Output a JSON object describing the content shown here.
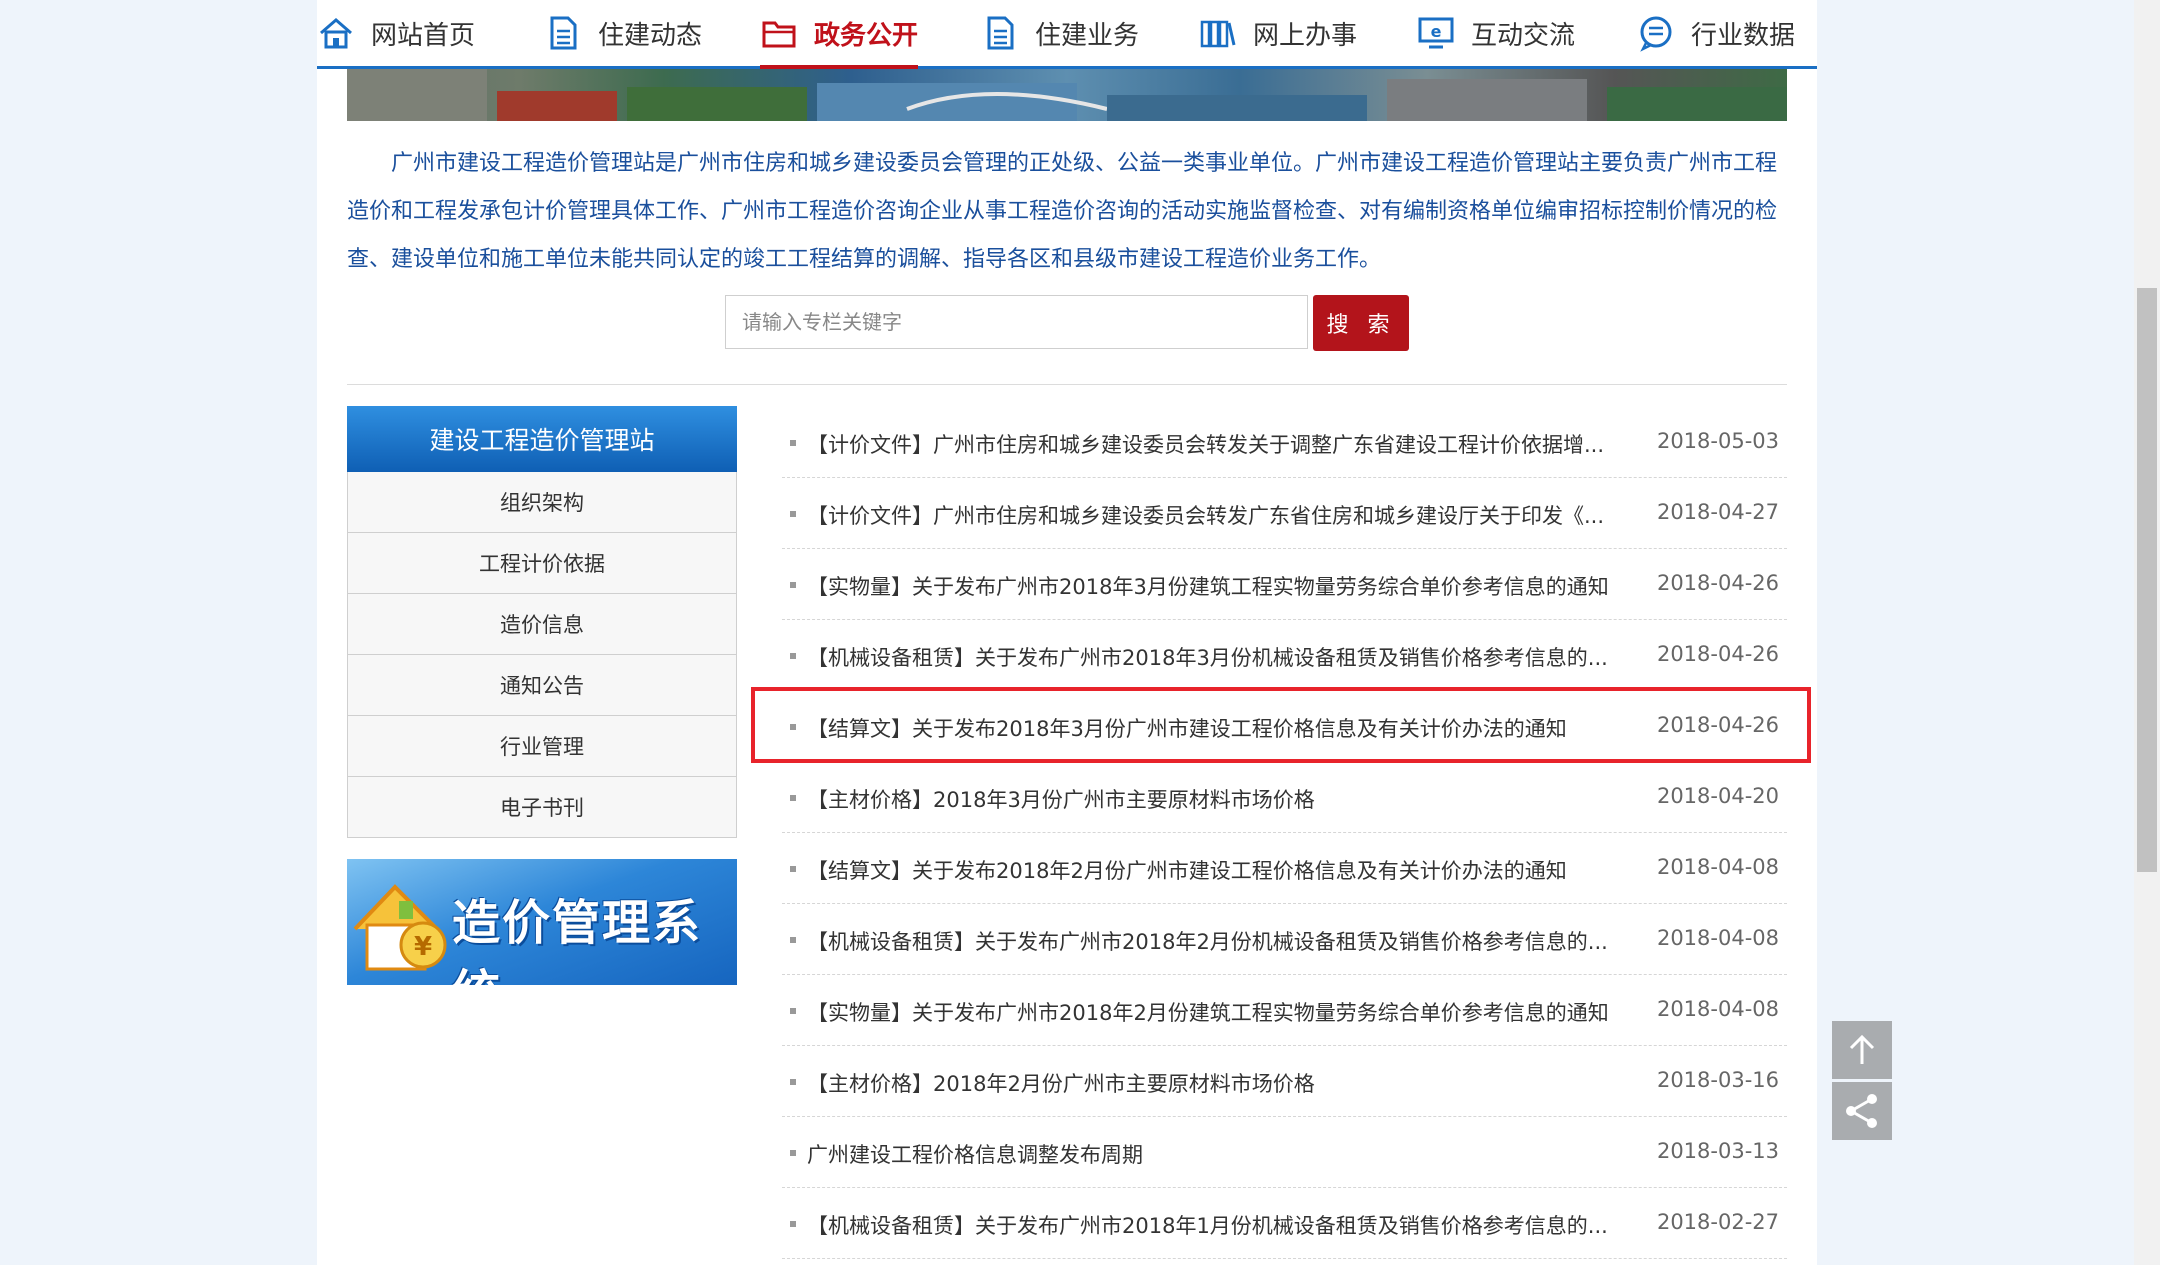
{
  "nav": [
    {
      "label": "网站首页",
      "icon": "home-icon",
      "active": false
    },
    {
      "label": "住建动态",
      "icon": "document-icon",
      "active": false
    },
    {
      "label": "政务公开",
      "icon": "folder-icon",
      "active": true
    },
    {
      "label": "住建业务",
      "icon": "document-icon",
      "active": false
    },
    {
      "label": "网上办事",
      "icon": "books-icon",
      "active": false
    },
    {
      "label": "互动交流",
      "icon": "monitor-icon",
      "active": false
    },
    {
      "label": "行业数据",
      "icon": "chat-icon",
      "active": false
    }
  ],
  "intro": "广州市建设工程造价管理站是广州市住房和城乡建设委员会管理的正处级、公益一类事业单位。广州市建设工程造价管理站主要负责广州市工程造价和工程发承包计价管理具体工作、广州市工程造价咨询企业从事工程造价咨询的活动实施监督检查、对有编制资格单位编审招标控制价情况的检查、建设单位和施工单位未能共同认定的竣工工程结算的调解、指导各区和县级市建设工程造价业务工作。",
  "search": {
    "placeholder": "请输入专栏关键字",
    "button": "搜 索"
  },
  "sidebar": {
    "title": "建设工程造价管理站",
    "items": [
      "组织架构",
      "工程计价依据",
      "造价信息",
      "通知公告",
      "行业管理",
      "电子书刊"
    ],
    "banner_text": "造价管理系统"
  },
  "list": [
    {
      "title": "【计价文件】广州市住房和城乡建设委员会转发关于调整广东省建设工程计价依据增...",
      "date": "2018-05-03"
    },
    {
      "title": "【计价文件】广州市住房和城乡建设委员会转发广东省住房和城乡建设厅关于印发《...",
      "date": "2018-04-27"
    },
    {
      "title": "【实物量】关于发布广州市2018年3月份建筑工程实物量劳务综合单价参考信息的通知",
      "date": "2018-04-26"
    },
    {
      "title": "【机械设备租赁】关于发布广州市2018年3月份机械设备租赁及销售价格参考信息的...",
      "date": "2018-04-26"
    },
    {
      "title": "【结算文】关于发布2018年3月份广州市建设工程价格信息及有关计价办法的通知",
      "date": "2018-04-26"
    },
    {
      "title": "【主材价格】2018年3月份广州市主要原材料市场价格",
      "date": "2018-04-20"
    },
    {
      "title": "【结算文】关于发布2018年2月份广州市建设工程价格信息及有关计价办法的通知",
      "date": "2018-04-08"
    },
    {
      "title": "【机械设备租赁】关于发布广州市2018年2月份机械设备租赁及销售价格参考信息的...",
      "date": "2018-04-08"
    },
    {
      "title": "【实物量】关于发布广州市2018年2月份建筑工程实物量劳务综合单价参考信息的通知",
      "date": "2018-04-08"
    },
    {
      "title": "【主材价格】2018年2月份广州市主要原材料市场价格",
      "date": "2018-03-16"
    },
    {
      "title": "广州建设工程价格信息调整发布周期",
      "date": "2018-03-13"
    },
    {
      "title": "【机械设备租赁】关于发布广州市2018年1月份机械设备租赁及销售价格参考信息的...",
      "date": "2018-02-27"
    }
  ],
  "colors": {
    "accent": "#c0111a",
    "nav_border": "#1a6fc4",
    "link": "#1a4f9c",
    "highlight": "#e8232b"
  }
}
